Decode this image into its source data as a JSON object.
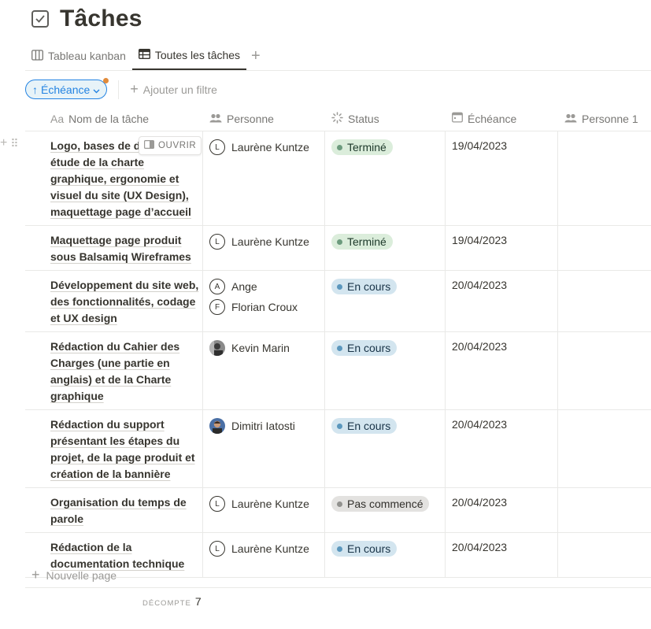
{
  "page": {
    "title": "Tâches"
  },
  "tabs": [
    {
      "label": "Tableau kanban",
      "icon": "board-icon",
      "active": false
    },
    {
      "label": "Toutes les tâches",
      "icon": "table-icon",
      "active": true
    }
  ],
  "filters": {
    "sort_label": "Échéance",
    "add_filter_label": "Ajouter un filtre"
  },
  "columns": {
    "name": "Nom de la tâche",
    "person": "Personne",
    "status": "Status",
    "due": "Échéance",
    "person1": "Personne 1"
  },
  "rows": [
    {
      "name": "Logo, bases de design, étude de la charte graphique, ergonomie et visuel du site (UX Design), maquettage page d'accueil",
      "name_lines": [
        "Logo, bases de do",
        "étude de la charte",
        "graphique, ergonomie et",
        "visuel du site (UX Design),",
        "maquettage page d’accueil"
      ],
      "people": [
        {
          "initial": "L",
          "name": "Laurène Kuntze"
        }
      ],
      "status": "Terminé",
      "status_kind": "done",
      "due": "19/04/2023"
    },
    {
      "name": "Maquettage page produit sous Balsamiq Wireframes",
      "name_lines": [
        "Maquettage page produit",
        "sous Balsamiq Wireframes"
      ],
      "people": [
        {
          "initial": "L",
          "name": "Laurène Kuntze"
        }
      ],
      "status": "Terminé",
      "status_kind": "done",
      "due": "19/04/2023"
    },
    {
      "name": "Développement du site web, des fonctionnalités, codage et UX design",
      "name_lines": [
        "Développement du site web,",
        "des fonctionnalités, codage",
        "et UX design"
      ],
      "people": [
        {
          "initial": "A",
          "name": "Ange"
        },
        {
          "initial": "F",
          "name": "Florian Croux"
        }
      ],
      "status": "En cours",
      "status_kind": "progress",
      "due": "20/04/2023"
    },
    {
      "name": "Rédaction du Cahier des Charges (une partie en anglais) et de la Charte graphique",
      "name_lines": [
        "Rédaction du Cahier des",
        "Charges (une partie en",
        "anglais) et de la Charte",
        "graphique"
      ],
      "people": [
        {
          "initial": "",
          "name": "Kevin Marin",
          "photo": "kevin"
        }
      ],
      "status": "En cours",
      "status_kind": "progress",
      "due": "20/04/2023"
    },
    {
      "name": "Rédaction du support présentant les étapes du projet, de la page produit et création de la bannière",
      "name_lines": [
        "Rédaction du support",
        "présentant les étapes du",
        "projet, de la page produit et",
        "création de la bannière"
      ],
      "people": [
        {
          "initial": "",
          "name": "Dimitri Iatosti",
          "photo": "dimitri"
        }
      ],
      "status": "En cours",
      "status_kind": "progress",
      "due": "20/04/2023"
    },
    {
      "name": "Organisation du temps de parole",
      "name_lines": [
        "Organisation du temps de",
        "parole"
      ],
      "people": [
        {
          "initial": "L",
          "name": "Laurène Kuntze"
        }
      ],
      "status": "Pas commencé",
      "status_kind": "todo",
      "due": "20/04/2023"
    },
    {
      "name": "Rédaction de la documentation technique",
      "name_lines": [
        "Rédaction de la",
        "documentation technique"
      ],
      "people": [
        {
          "initial": "L",
          "name": "Laurène Kuntze"
        }
      ],
      "status": "En cours",
      "status_kind": "progress",
      "due": "20/04/2023"
    }
  ],
  "row_actions": {
    "open_label": "OUVRIR"
  },
  "footer": {
    "new_page_label": "Nouvelle page",
    "count_label": "DÉCOMPTE",
    "count_value": "7"
  },
  "colors": {
    "done_bg": "#dbeddb",
    "done_text": "#1c3829",
    "done_dot": "#6c9b7d",
    "progress_bg": "#d3e5ef",
    "progress_text": "#183347",
    "progress_dot": "#5b97bd",
    "todo_bg": "#e3e2e0",
    "todo_text": "#32302c",
    "todo_dot": "#91918e"
  }
}
